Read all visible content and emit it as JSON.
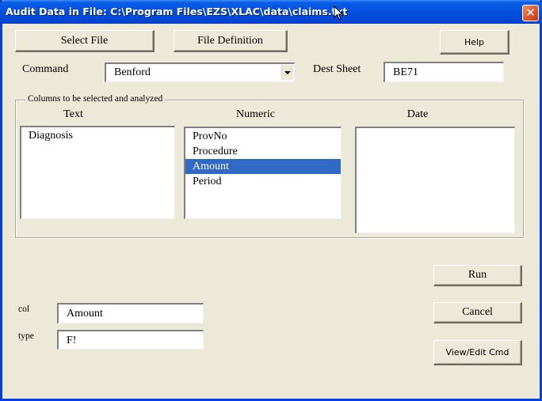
{
  "window": {
    "title": "Audit Data in File: C:\\Program Files\\EZS\\XLAC\\data\\claims.txt",
    "close_glyph": "✕"
  },
  "toolbar": {
    "select_file_label": "Select File",
    "file_definition_label": "File Definition",
    "help_label": "Help"
  },
  "command": {
    "label": "Command",
    "value": "Benford"
  },
  "dest_sheet": {
    "label": "Dest Sheet",
    "value": "BE71"
  },
  "columns_group": {
    "legend": "Columns to be selected and analyzed",
    "text": {
      "title": "Text",
      "items": [
        {
          "label": "Diagnosis",
          "selected": false
        }
      ]
    },
    "numeric": {
      "title": "Numeric",
      "items": [
        {
          "label": "ProvNo",
          "selected": false
        },
        {
          "label": "Procedure",
          "selected": false
        },
        {
          "label": "Amount",
          "selected": true
        },
        {
          "label": "Period",
          "selected": false
        }
      ]
    },
    "date": {
      "title": "Date",
      "items": []
    }
  },
  "col_field": {
    "label": "col",
    "value": "Amount"
  },
  "type_field": {
    "label": "type",
    "value": "F!"
  },
  "actions": {
    "run_label": "Run",
    "cancel_label": "Cancel",
    "view_edit_label": "View/Edit Cmd"
  },
  "colors": {
    "titlebar": "#0551e0",
    "face": "#ece9d8",
    "selection": "#316ac5"
  }
}
